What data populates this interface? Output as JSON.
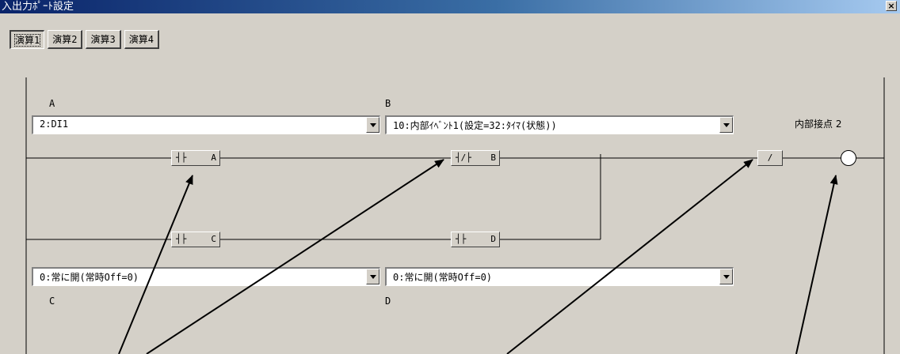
{
  "window": {
    "title": "入出力ﾎﾟｰﾄ設定",
    "close_glyph": "×"
  },
  "tabs": [
    {
      "label": "演算1",
      "active": true
    },
    {
      "label": "演算2",
      "active": false
    },
    {
      "label": "演算3",
      "active": false
    },
    {
      "label": "演算4",
      "active": false
    }
  ],
  "fields": {
    "a": {
      "label": "A",
      "value": "2:DI1"
    },
    "b": {
      "label": "B",
      "value": "10:内部ｲﾍﾞﾝﾄ1(設定=32:ﾀｲﾏ(状態))"
    },
    "c": {
      "label": "C",
      "value": "0:常に開(常時Off=0)"
    },
    "d": {
      "label": "D",
      "value": "0:常に開(常時Off=0)"
    }
  },
  "output": {
    "label": "内部接点 2"
  },
  "contacts": {
    "a": {
      "symbol": "┤├",
      "letter": "A",
      "type": "normally-open"
    },
    "b": {
      "symbol": "┤/├",
      "letter": "B",
      "type": "normally-closed"
    },
    "c": {
      "symbol": "┤├",
      "letter": "C",
      "type": "normally-open"
    },
    "d": {
      "symbol": "┤├",
      "letter": "D",
      "type": "normally-open"
    },
    "out": {
      "symbol": "/",
      "type": "invert"
    }
  },
  "colors": {
    "face": "#d4d0c8",
    "title_start": "#0a246a",
    "title_end": "#a6caf0"
  }
}
